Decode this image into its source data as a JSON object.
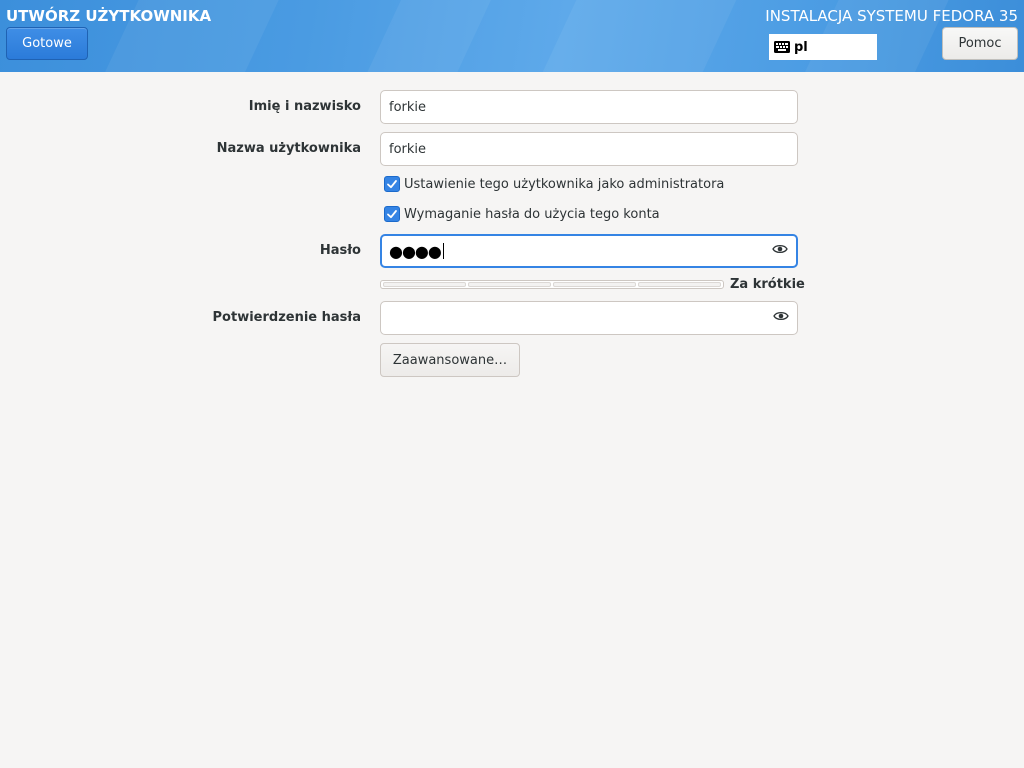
{
  "header": {
    "spoke_title": "UTWÓRZ UŻYTKOWNIKA",
    "done_label": "Gotowe",
    "product_title": "INSTALACJA SYSTEMU FEDORA 35",
    "keyboard_layout": "pl",
    "help_label": "Pomoc"
  },
  "form": {
    "fullname_label": "Imię i nazwisko",
    "fullname_value": "forkie",
    "username_label": "Nazwa użytkownika",
    "username_value": "forkie",
    "admin_checkbox_label": "Ustawienie tego użytkownika jako administratora",
    "admin_checked": true,
    "require_password_label": "Wymaganie hasła do użycia tego konta",
    "require_password_checked": true,
    "password_label": "Hasło",
    "password_value": "●●●●",
    "password_strength_label": "Za krótkie",
    "password_strength_level": 0,
    "confirm_label": "Potwierdzenie hasła",
    "confirm_value": "",
    "advanced_label": "Zaawansowane…"
  },
  "icons": {
    "keyboard": "keyboard-icon",
    "reveal": "eye-icon",
    "check": "checkmark-icon"
  },
  "colors": {
    "accent": "#3584e4",
    "header_blue": "#4a9be2"
  }
}
